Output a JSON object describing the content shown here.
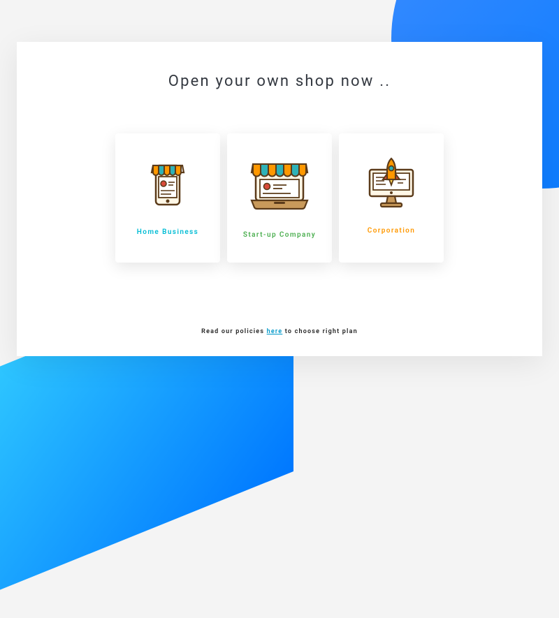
{
  "heading": "Open your own shop now ..",
  "cards": [
    {
      "label": "Home Business"
    },
    {
      "label": "Start-up Company"
    },
    {
      "label": "Corporation"
    }
  ],
  "policy": {
    "pre": "Read our policies ",
    "link": "here",
    "post": " to choose right plan"
  }
}
